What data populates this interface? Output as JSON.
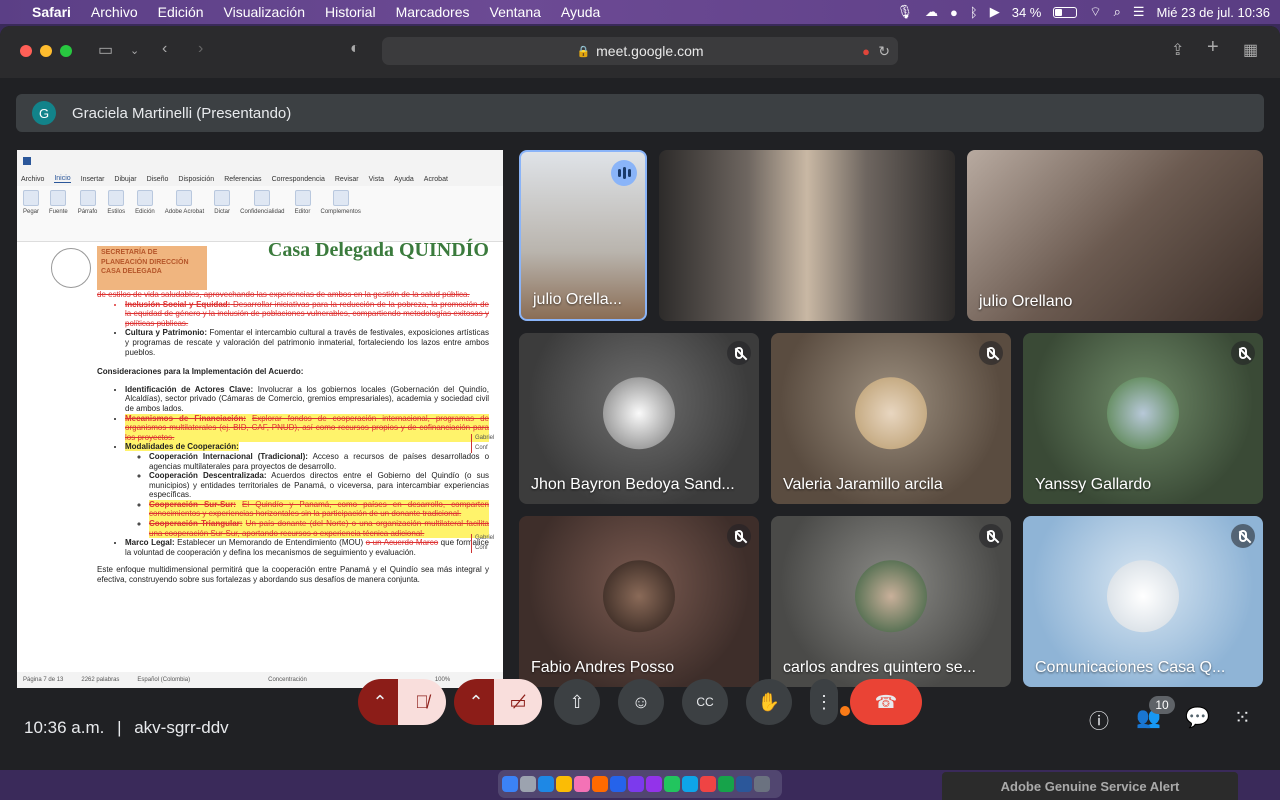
{
  "menubar": {
    "app": "Safari",
    "items": [
      "Archivo",
      "Edición",
      "Visualización",
      "Historial",
      "Marcadores",
      "Ventana",
      "Ayuda"
    ],
    "battery": "34 %",
    "datetime": "Mié 23 de jul.  10:36"
  },
  "browser": {
    "url": "meet.google.com"
  },
  "presenter": {
    "initial": "G",
    "name": "Graciela Martinelli (Presentando)"
  },
  "document": {
    "ribbon_tabs": [
      "Archivo",
      "Inicio",
      "Insertar",
      "Dibujar",
      "Diseño",
      "Disposición",
      "Referencias",
      "Correspondencia",
      "Revisar",
      "Vista",
      "Ayuda",
      "Acrobat"
    ],
    "ribbon_groups": [
      "Pegar",
      "Fuente",
      "Párrafo",
      "Estilos",
      "Edición",
      "Adobe Acrobat",
      "Dictar",
      "Confidencialidad",
      "Editor",
      "Complementos"
    ],
    "header_office": "SECRETARÍA DE PLANEACIÓN DIRECCIÓN CASA DELEGADA",
    "header_logo": "Casa Delegada QUINDÍO",
    "line1": "de estilos de vida saludables, aprovechando las experiencias de ambos en la gestión de la salud pública.",
    "inclusion_title": "Inclusión Social y Equidad:",
    "inclusion_text": "Desarrollar iniciativas para la reducción de la pobreza, la promoción de la equidad de género y la inclusión de poblaciones vulnerables, compartiendo metodologías exitosas y políticas públicas.",
    "cultura_title": "Cultura y Patrimonio:",
    "cultura_text": "Fomentar el intercambio cultural a través de festivales, exposiciones artísticas y programas de rescate y valoración del patrimonio inmaterial, fortaleciendo los lazos entre ambos pueblos.",
    "section_title": "Consideraciones para la Implementación del Acuerdo:",
    "actores_title": "Identificación de Actores Clave:",
    "actores_text": "Involucrar a los gobiernos locales (Gobernación del Quindío, Alcaldías), sector privado (Cámaras de Comercio, gremios empresariales), academia y sociedad civil de ambos lados.",
    "mecanismos_title": "Mecanismos de Financiación:",
    "mecanismos_text": "Explorar fondos de cooperación internacional, programas de organismos multilaterales (ej. BID, CAF, PNUD), así como recursos propios y de cofinanciación para los proyectos.",
    "modalidades_title": "Modalidades de Cooperación:",
    "coop_intl_title": "Cooperación Internacional (Tradicional):",
    "coop_intl_text": "Acceso a recursos de países desarrollados o agencias multilaterales para proyectos de desarrollo.",
    "coop_desc_title": "Cooperación Descentralizada:",
    "coop_desc_text": "Acuerdos directos entre el Gobierno del Quindío (o sus municipios) y entidades territoriales de Panamá, o viceversa, para intercambiar experiencias específicas.",
    "coop_sur_title": "Cooperación Sur-Sur:",
    "coop_sur_text": "El Quindío y Panamá, como países en desarrollo, comparten conocimientos y experiencias horizontales sin la participación de un donante tradicional.",
    "coop_tri_title": "Cooperación Triangular:",
    "coop_tri_text": "Un país donante (del Norte) o una organización multilateral facilita una cooperación Sur-Sur, aportando recursos o experiencia técnica adicional.",
    "marco_title": "Marco Legal:",
    "marco_text": "Establecer un Memorando de Entendimiento (MOU)",
    "marco_del": "o un Acuerdo Marco",
    "marco_text2": "que formalice la voluntad de cooperación y defina los mecanismos de seguimiento y evaluación.",
    "closing": "Este enfoque multidimensional permitirá que la cooperación entre Panamá y el Quindío sea más integral y efectiva, construyendo sobre sus fortalezas y abordando sus desafíos de manera conjunta.",
    "comment1": "Gabriel Conf",
    "comment2": "Gabriel Conf",
    "status_page": "Página 7 de 13",
    "status_words": "2262 palabras",
    "status_lang": "Español (Colombia)",
    "status_focus": "Concentración",
    "status_zoom": "100%"
  },
  "participants": [
    {
      "name": "julio Orella...",
      "speaking": true
    },
    {
      "name": ""
    },
    {
      "name": "julio Orellano"
    },
    {
      "name": "Jhon Bayron Bedoya Sand...",
      "muted": true
    },
    {
      "name": "Valeria Jaramillo arcila",
      "muted": true
    },
    {
      "name": "Yanssy Gallardo",
      "muted": true
    },
    {
      "name": "Fabio Andres Posso",
      "muted": true
    },
    {
      "name": "carlos andres quintero se...",
      "muted": true
    },
    {
      "name": "Comunicaciones Casa Q...",
      "muted": true
    }
  ],
  "meeting": {
    "time": "10:36 a.m.",
    "separator": "|",
    "code": "akv-sgrr-ddv",
    "participant_count": "10"
  },
  "dock_alert": "Adobe Genuine Service Alert",
  "colors": {
    "end_call": "#ea4335",
    "muted_dark": "#8c1d18",
    "muted_light": "#f9dedc",
    "speaking_ring": "#8ab4f8"
  }
}
